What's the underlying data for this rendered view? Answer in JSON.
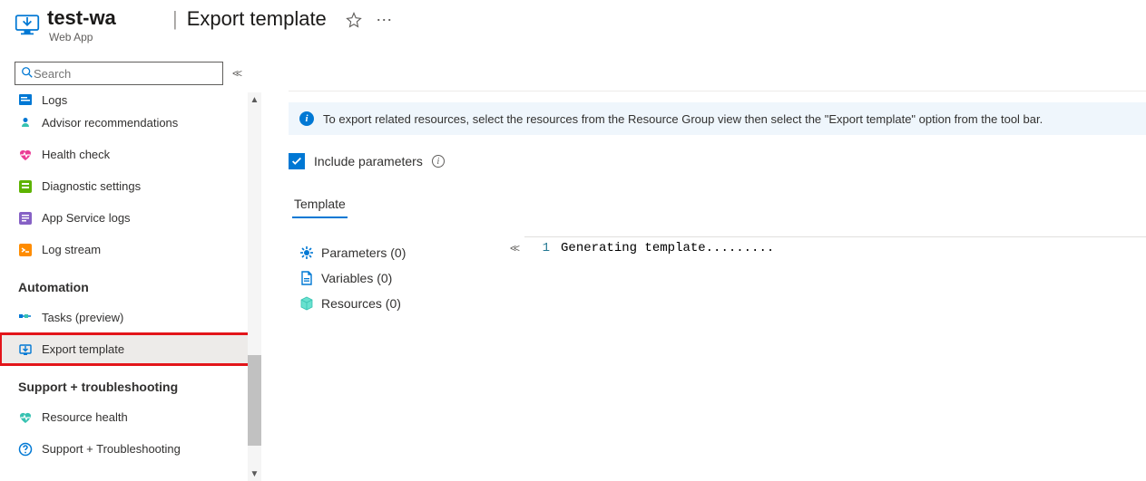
{
  "header": {
    "resource_name": "test-wa",
    "resource_type": "Web App",
    "page_title": "Export template",
    "separator": "|"
  },
  "sidebar": {
    "search_placeholder": "Search",
    "truncated_item": {
      "label": "Logs",
      "icon": "logs-icon"
    },
    "items_pre": [
      {
        "label": "Advisor recommendations",
        "icon": "advisor-icon"
      },
      {
        "label": "Health check",
        "icon": "health-icon"
      },
      {
        "label": "Diagnostic settings",
        "icon": "diag-icon"
      },
      {
        "label": "App Service logs",
        "icon": "app-logs-icon"
      },
      {
        "label": "Log stream",
        "icon": "log-stream-icon"
      }
    ],
    "section_automation": "Automation",
    "items_automation": [
      {
        "label": "Tasks (preview)",
        "icon": "tasks-icon"
      },
      {
        "label": "Export template",
        "icon": "export-icon"
      }
    ],
    "section_support": "Support + troubleshooting",
    "items_support": [
      {
        "label": "Resource health",
        "icon": "res-health-icon"
      },
      {
        "label": "Support + Troubleshooting",
        "icon": "support-icon"
      }
    ]
  },
  "main": {
    "info_text": "To export related resources, select the resources from the Resource Group view then select the \"Export template\" option from the tool bar.",
    "include_params_label": "Include parameters",
    "tab_template": "Template",
    "tree": {
      "parameters": "Parameters (0)",
      "variables": "Variables (0)",
      "resources": "Resources (0)"
    },
    "code": {
      "line_no": "1",
      "line_text": "Generating template........."
    }
  }
}
